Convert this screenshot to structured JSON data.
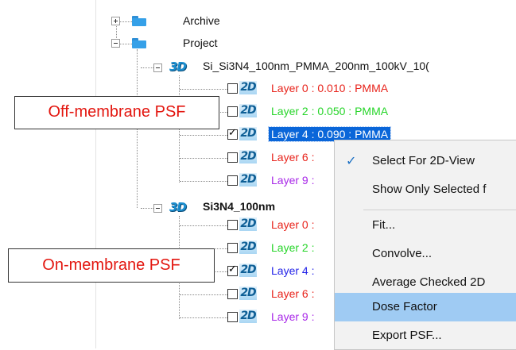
{
  "tree": {
    "archive_label": "Archive",
    "project_label": "Project",
    "sim1": {
      "label": "Si_Si3N4_100nm_PMMA_200nm_100kV_10(",
      "layers": [
        {
          "label": "Layer 0 : 0.010 : PMMA",
          "color": "#e8231b",
          "checked": false
        },
        {
          "label": "Layer 2 : 0.050 : PMMA",
          "color": "#27d52a",
          "checked": false
        },
        {
          "label": "Layer 4 : 0.090 : PMMA",
          "color": "#ffffff",
          "checked": true,
          "selected": true
        },
        {
          "label": "Layer 6 :",
          "color": "#e8231b",
          "checked": false
        },
        {
          "label": "Layer 9 :",
          "color": "#a827e8",
          "checked": false
        }
      ]
    },
    "sim2": {
      "label": "Si3N4_100nm",
      "layers": [
        {
          "label": "Layer 0 :",
          "color": "#e8231b",
          "checked": false
        },
        {
          "label": "Layer 2 :",
          "color": "#27d52a",
          "checked": false
        },
        {
          "label": "Layer 4 :",
          "color": "#2323e8",
          "checked": true
        },
        {
          "label": "Layer 6 :",
          "color": "#e8231b",
          "checked": false
        },
        {
          "label": "Layer 9 :",
          "color": "#a827e8",
          "checked": false
        }
      ]
    },
    "icon_3d": "3D",
    "icon_2d": "2D",
    "check_glyph": "✓"
  },
  "callouts": {
    "off": "Off-membrane PSF",
    "on": "On-membrane PSF"
  },
  "menu": {
    "items": [
      {
        "label": "Select For 2D-View",
        "checked": true
      },
      {
        "label": "Show Only Selected f",
        "checked": false
      },
      {
        "label": "Fit...",
        "checked": false
      },
      {
        "label": "Convolve...",
        "checked": false
      },
      {
        "label": "Average Checked 2D",
        "checked": false
      },
      {
        "label": "Dose Factor",
        "checked": false,
        "highlighted": true
      },
      {
        "label": "Export PSF...",
        "checked": false
      }
    ],
    "check_glyph": "✓"
  }
}
